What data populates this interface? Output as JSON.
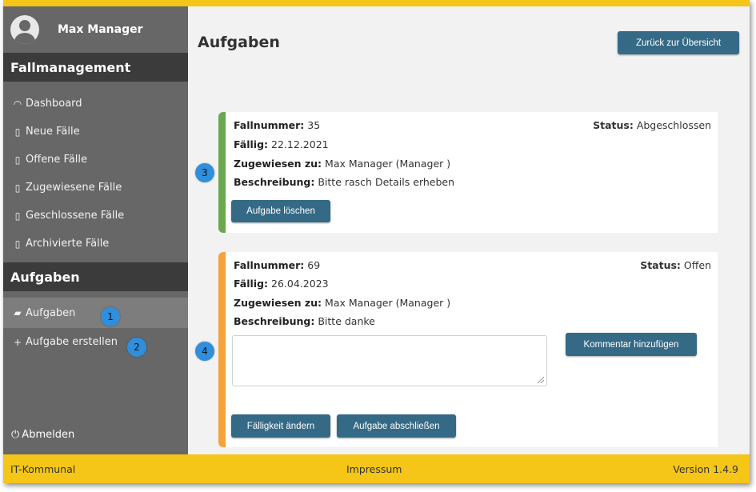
{
  "user": {
    "name": "Max Manager"
  },
  "sidebar": {
    "section1": "Fallmanagement",
    "items": [
      {
        "icon": "dashboard-icon",
        "glyph": "◠",
        "label": "Dashboard"
      },
      {
        "icon": "clipboard-icon",
        "glyph": "▯",
        "label": "Neue Fälle"
      },
      {
        "icon": "clipboard-list-icon",
        "glyph": "▯",
        "label": "Offene Fälle"
      },
      {
        "icon": "clipboard-user-icon",
        "glyph": "▯",
        "label": "Zugewiesene Fälle"
      },
      {
        "icon": "clipboard-check-icon",
        "glyph": "▯",
        "label": "Geschlossene Fälle"
      },
      {
        "icon": "clipboard-archive-icon",
        "glyph": "▯",
        "label": "Archivierte Fälle"
      }
    ],
    "section2": "Aufgaben",
    "tasks": [
      {
        "icon": "tasks-icon",
        "glyph": "▰",
        "label": "Aufgaben"
      },
      {
        "icon": "plus-icon",
        "glyph": "+",
        "label": "Aufgabe erstellen"
      }
    ],
    "logout": "Abmelden"
  },
  "badges": [
    "1",
    "2",
    "3",
    "4"
  ],
  "main": {
    "title": "Aufgaben",
    "back_button": "Zurück zur Übersicht"
  },
  "tasks": [
    {
      "fallnummer_label": "Fallnummer:",
      "fallnummer": "35",
      "faellig_label": "Fällig:",
      "faellig": "22.12.2021",
      "zugewiesen_label": "Zugewiesen zu:",
      "zugewiesen": "Max Manager (Manager )",
      "beschreibung_label": "Beschreibung:",
      "beschreibung": "Bitte rasch Details erheben",
      "status_label": "Status:",
      "status": "Abgeschlossen",
      "delete_button": "Aufgabe löschen",
      "accent": "#6aa84f"
    },
    {
      "fallnummer_label": "Fallnummer:",
      "fallnummer": "69",
      "faellig_label": "Fällig:",
      "faellig": "26.04.2023",
      "zugewiesen_label": "Zugewiesen zu:",
      "zugewiesen": "Max Manager (Manager )",
      "beschreibung_label": "Beschreibung:",
      "beschreibung": "Bitte danke",
      "status_label": "Status:",
      "status": "Offen",
      "comment_placeholder": "",
      "comment_button": "Kommentar hinzufügen",
      "change_due_button": "Fälligkeit ändern",
      "complete_button": "Aufgabe abschließen",
      "accent": "#f5a33a"
    }
  ],
  "footer": {
    "left": "IT-Kommunal",
    "center": "Impressum",
    "right": "Version 1.4.9"
  },
  "colors": {
    "primary_button": "#356a86",
    "sidebar": "#676767",
    "header_bar": "#f5c518",
    "badge": "#2f8fdc"
  }
}
